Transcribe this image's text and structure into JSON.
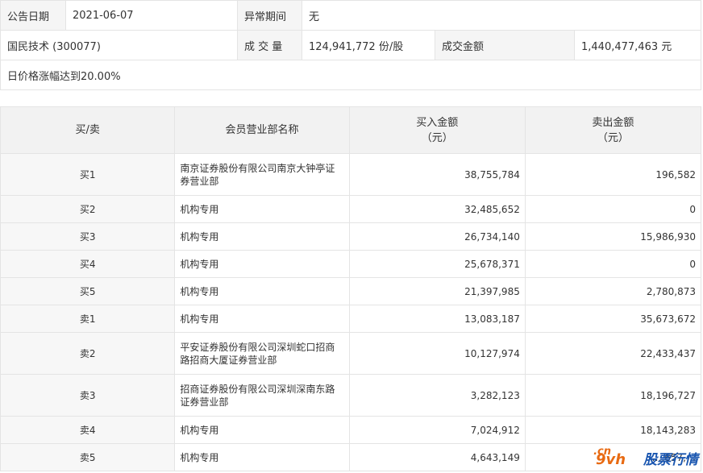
{
  "info": {
    "announce_label": "公告日期",
    "announce_value": "2021-06-07",
    "abnormal_label": "异常期间",
    "abnormal_value": "无",
    "stock": "国民技术 (300077)",
    "volume_label": "成 交 量",
    "volume_value": "124,941,772 份/股",
    "amount_label": "成交金额",
    "amount_value": "1,440,477,463 元",
    "reason": "日价格涨幅达到20.00%"
  },
  "table": {
    "headers": [
      "买/卖",
      "会员营业部名称",
      "买入金额\n（元）",
      "卖出金额\n（元）"
    ],
    "header_side": "买/卖",
    "header_name": "会员营业部名称",
    "header_buy_1": "买入金额",
    "header_buy_2": "（元）",
    "header_sell_1": "卖出金额",
    "header_sell_2": "（元）",
    "rows": [
      {
        "side": "买1",
        "name": "南京证券股份有限公司南京大钟亭证券营业部",
        "buy": "38,755,784",
        "sell": "196,582"
      },
      {
        "side": "买2",
        "name": "机构专用",
        "buy": "32,485,652",
        "sell": "0"
      },
      {
        "side": "买3",
        "name": "机构专用",
        "buy": "26,734,140",
        "sell": "15,986,930"
      },
      {
        "side": "买4",
        "name": "机构专用",
        "buy": "25,678,371",
        "sell": "0"
      },
      {
        "side": "买5",
        "name": "机构专用",
        "buy": "21,397,985",
        "sell": "2,780,873"
      },
      {
        "side": "卖1",
        "name": "机构专用",
        "buy": "13,083,187",
        "sell": "35,673,672"
      },
      {
        "side": "卖2",
        "name": "平安证券股份有限公司深圳蛇口招商路招商大厦证券营业部",
        "buy": "10,127,974",
        "sell": "22,433,437"
      },
      {
        "side": "卖3",
        "name": "招商证券股份有限公司深圳深南东路证券营业部",
        "buy": "3,282,123",
        "sell": "18,196,727"
      },
      {
        "side": "卖4",
        "name": "机构专用",
        "buy": "7,024,912",
        "sell": "18,143,283"
      },
      {
        "side": "卖5",
        "name": "机构专用",
        "buy": "4,643,149",
        "sell": "…,657,…"
      }
    ]
  },
  "watermark": {
    "logo": "9vh",
    "domain": ".cn",
    "text": "股票行情"
  }
}
